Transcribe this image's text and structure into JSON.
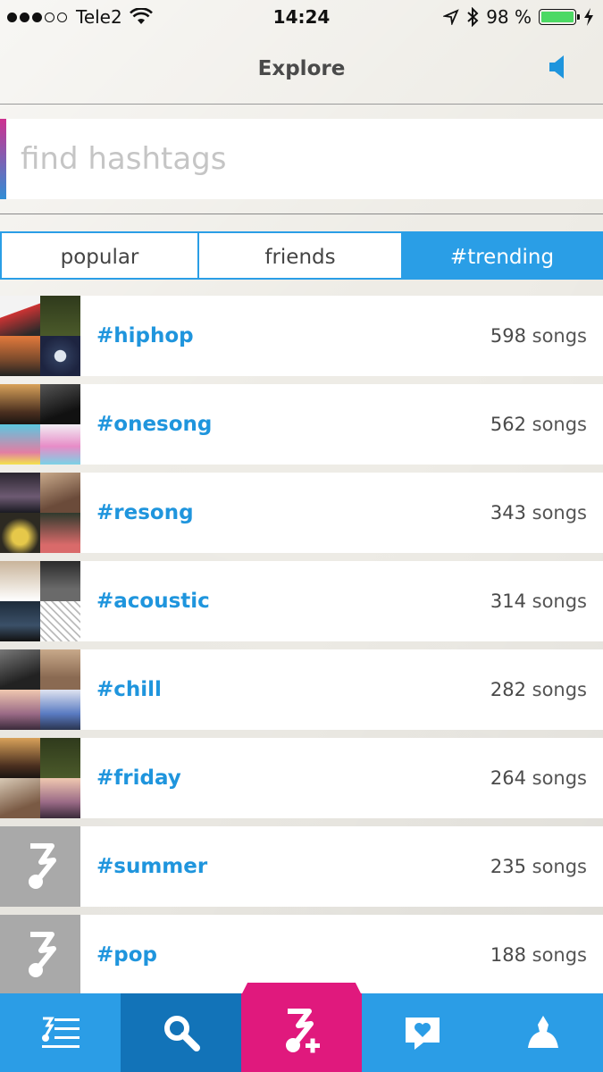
{
  "status_bar": {
    "carrier": "Tele2",
    "time": "14:24",
    "battery_percent": "98 %",
    "signal_bars_filled": 3
  },
  "nav": {
    "title": "Explore"
  },
  "search": {
    "placeholder": "find hashtags",
    "value": ""
  },
  "tabs": [
    {
      "label": "popular",
      "selected": false
    },
    {
      "label": "friends",
      "selected": false
    },
    {
      "label": "#trending",
      "selected": true
    }
  ],
  "hashtags": [
    {
      "tag": "#hiphop",
      "count": "598",
      "unit": "songs",
      "thumb": "covers"
    },
    {
      "tag": "#onesong",
      "count": "562",
      "unit": "songs",
      "thumb": "covers"
    },
    {
      "tag": "#resong",
      "count": "343",
      "unit": "songs",
      "thumb": "covers"
    },
    {
      "tag": "#acoustic",
      "count": "314",
      "unit": "songs",
      "thumb": "covers"
    },
    {
      "tag": "#chill",
      "count": "282",
      "unit": "songs",
      "thumb": "covers"
    },
    {
      "tag": "#friday",
      "count": "264",
      "unit": "songs",
      "thumb": "covers"
    },
    {
      "tag": "#summer",
      "count": "235",
      "unit": "songs",
      "thumb": "music-note-placeholder"
    },
    {
      "tag": "#pop",
      "count": "188",
      "unit": "songs",
      "thumb": "music-note-placeholder"
    }
  ],
  "tabbar": [
    {
      "icon": "playlist-icon"
    },
    {
      "icon": "search-icon",
      "selected": true
    },
    {
      "icon": "add-song-icon"
    },
    {
      "icon": "chat-heart-icon"
    },
    {
      "icon": "profile-icon"
    }
  ],
  "colors": {
    "accent_blue": "#2a9ee6",
    "dark_blue": "#1273b8",
    "pink": "#e0197d",
    "hashtag_blue": "#1f95dd"
  }
}
